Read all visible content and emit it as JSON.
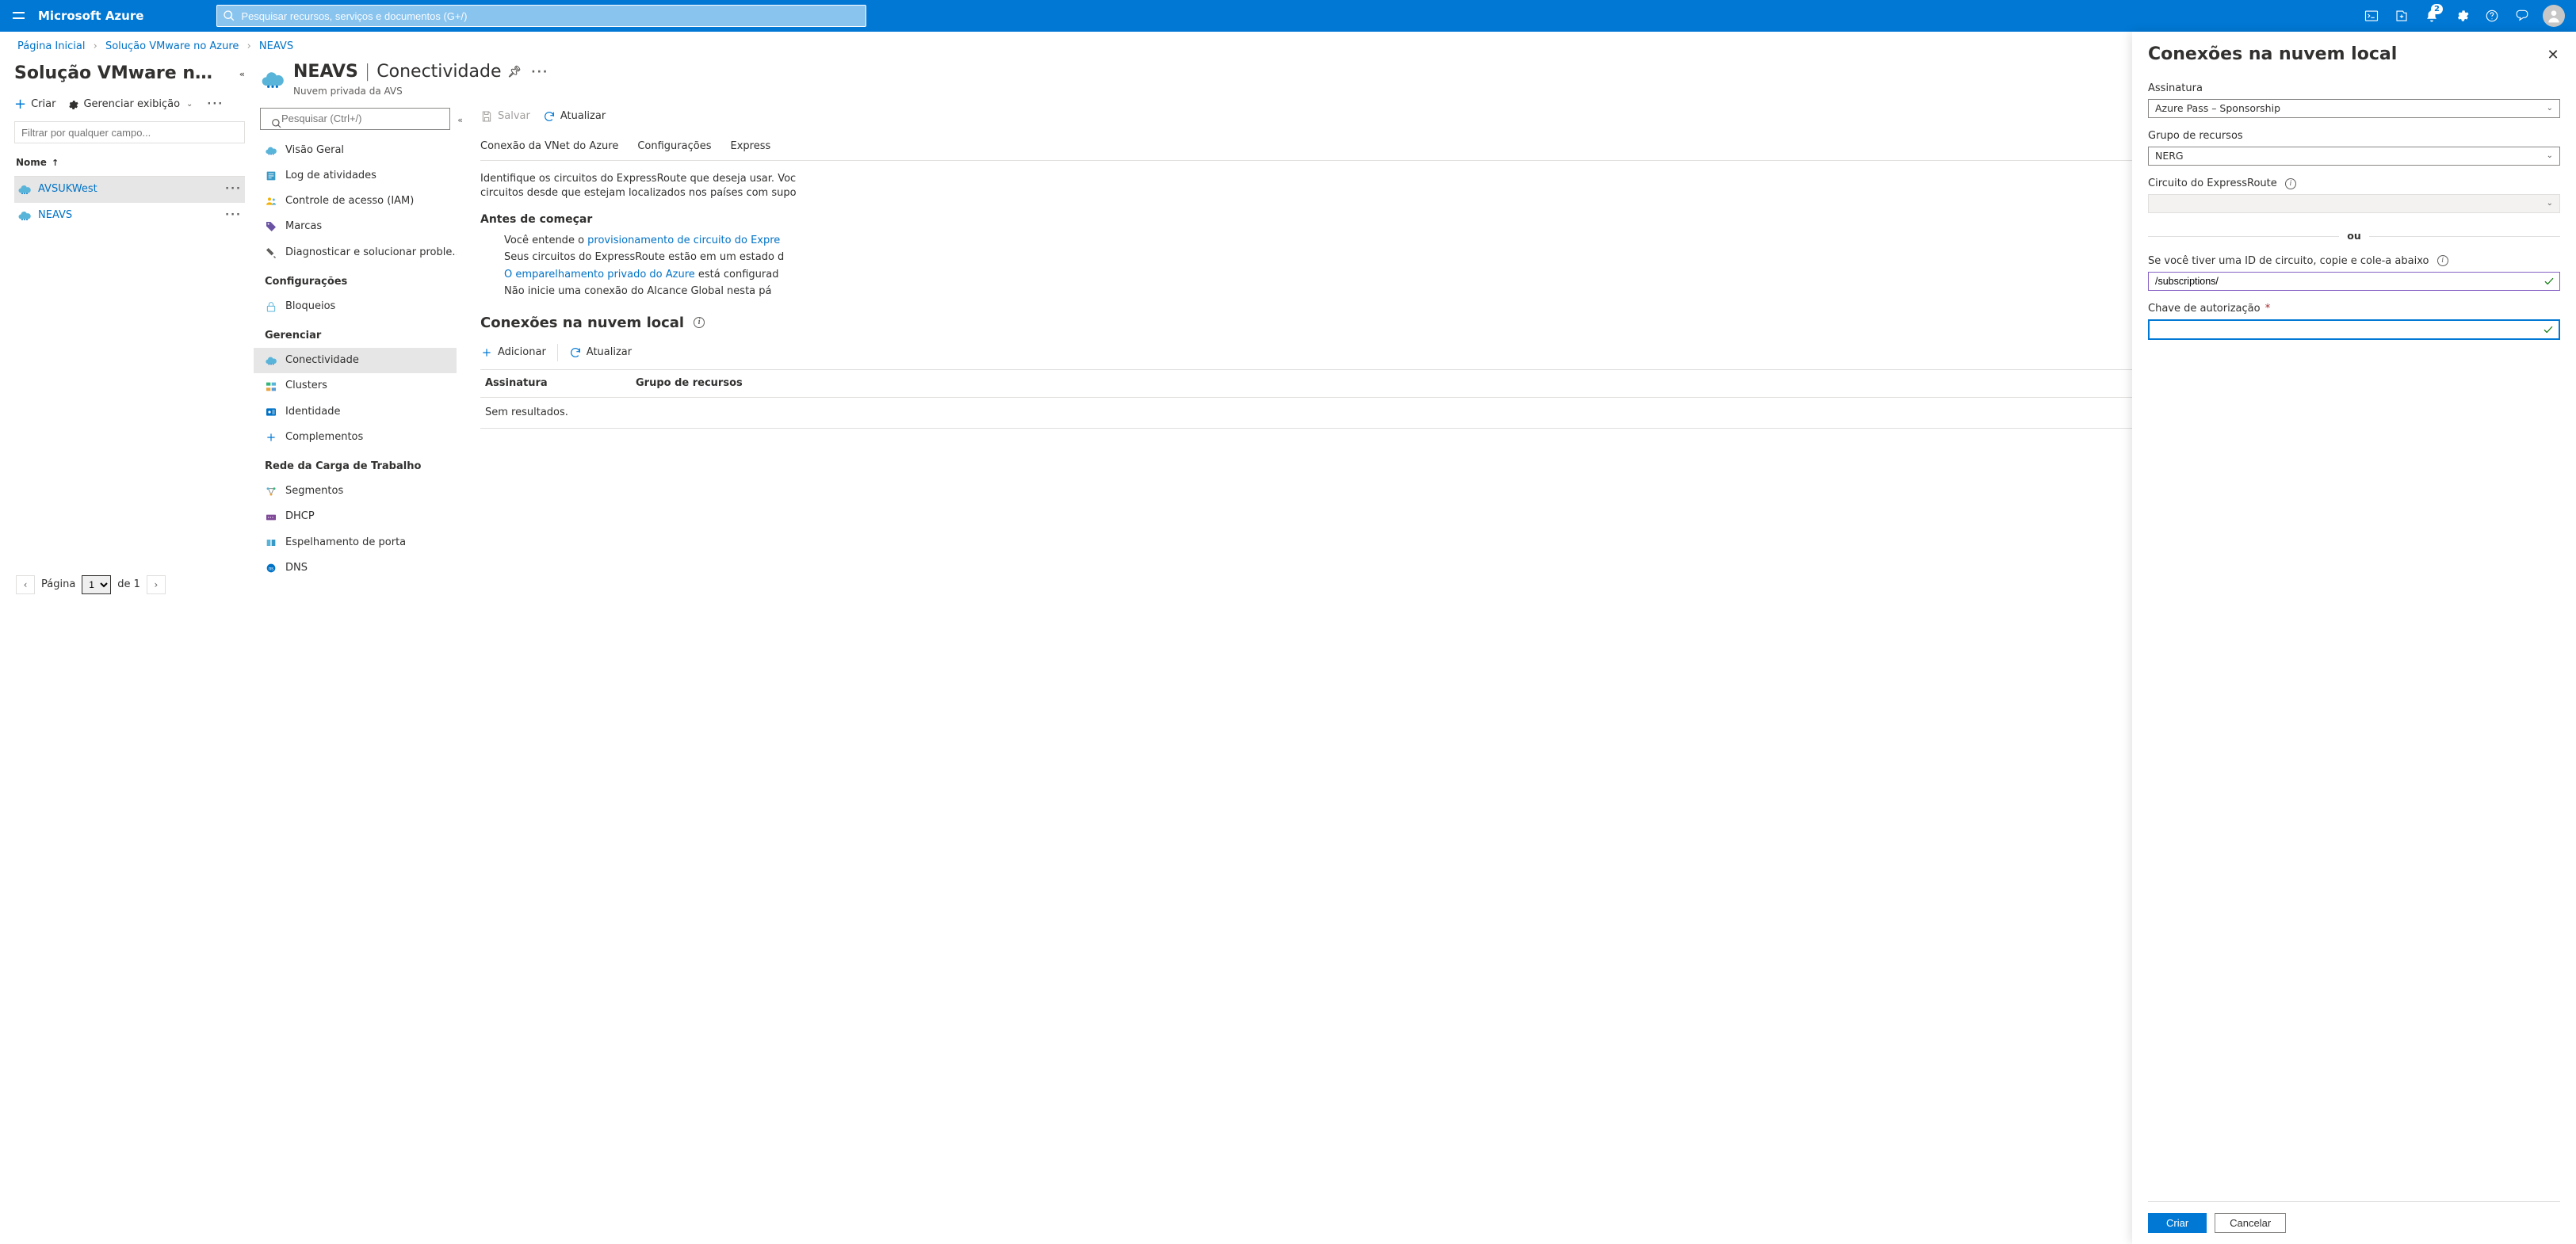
{
  "topbar": {
    "brand": "Microsoft Azure",
    "search_placeholder": "Pesquisar recursos, serviços e documentos (G+/)",
    "notification_count": "2"
  },
  "breadcrumb": {
    "home": "Página Inicial",
    "service": "Solução VMware no Azure",
    "resource": "NEAVS"
  },
  "col1": {
    "title": "Solução VMware n…",
    "create": "Criar",
    "manage_view": "Gerenciar exibição",
    "filter_placeholder": "Filtrar por qualquer campo...",
    "name_header": "Nome",
    "rows": [
      {
        "name": "AVSUKWest"
      },
      {
        "name": "NEAVS"
      }
    ],
    "pager_prefix": "Página",
    "pager_page": "1",
    "pager_suffix": "de 1"
  },
  "resource_header": {
    "name": "NEAVS",
    "section": "Conectividade",
    "subtitle": "Nuvem privada da AVS"
  },
  "sidenav": {
    "search_placeholder": "Pesquisar (Ctrl+/)",
    "items_top": [
      {
        "label": "Visão Geral"
      },
      {
        "label": "Log de atividades"
      },
      {
        "label": "Controle de acesso (IAM)"
      },
      {
        "label": "Marcas"
      },
      {
        "label": "Diagnosticar e solucionar proble..."
      }
    ],
    "head_config": "Configurações",
    "items_config": [
      {
        "label": "Bloqueios"
      }
    ],
    "head_manage": "Gerenciar",
    "items_manage": [
      {
        "label": "Conectividade"
      },
      {
        "label": "Clusters"
      },
      {
        "label": "Identidade"
      },
      {
        "label": "Complementos"
      }
    ],
    "head_workload": "Rede da Carga de Trabalho",
    "items_workload": [
      {
        "label": "Segmentos"
      },
      {
        "label": "DHCP"
      },
      {
        "label": "Espelhamento de porta"
      },
      {
        "label": "DNS"
      }
    ]
  },
  "commands": {
    "save": "Salvar",
    "refresh": "Atualizar"
  },
  "tabs": [
    "Conexão da VNet do Azure",
    "Configurações",
    "Express"
  ],
  "content": {
    "intro1": "Identifique os circuitos do ExpressRoute que deseja usar. Voc",
    "intro2": "circuitos desde que estejam localizados nos países com supo",
    "before": "Antes de começar",
    "b1_pre": "Você entende o ",
    "b1_link": "provisionamento de circuito do Expre",
    "b2": "Seus circuitos do ExpressRoute estão em um estado d",
    "b3_link": "O emparelhamento privado do Azure",
    "b3_post": " está configurad",
    "b4": "Não inicie uma conexão do Alcance Global nesta pá",
    "section": "Conexões na nuvem local",
    "add": "Adicionar",
    "refresh": "Atualizar",
    "th1": "Assinatura",
    "th2": "Grupo de recursos",
    "empty": "Sem resultados."
  },
  "flyout": {
    "title": "Conexões na nuvem local",
    "subscription_label": "Assinatura",
    "subscription_value": "Azure Pass – Sponsorship",
    "rg_label": "Grupo de recursos",
    "rg_value": "NERG",
    "circuit_label": "Circuito do ExpressRoute",
    "circuit_value": "",
    "or": "ou",
    "circuitid_label": "Se você tiver uma ID de circuito, copie e cole-a abaixo",
    "circuitid_value": "/subscriptions/",
    "authkey_label": "Chave de autorização",
    "authkey_value": "",
    "create": "Criar",
    "cancel": "Cancelar"
  }
}
